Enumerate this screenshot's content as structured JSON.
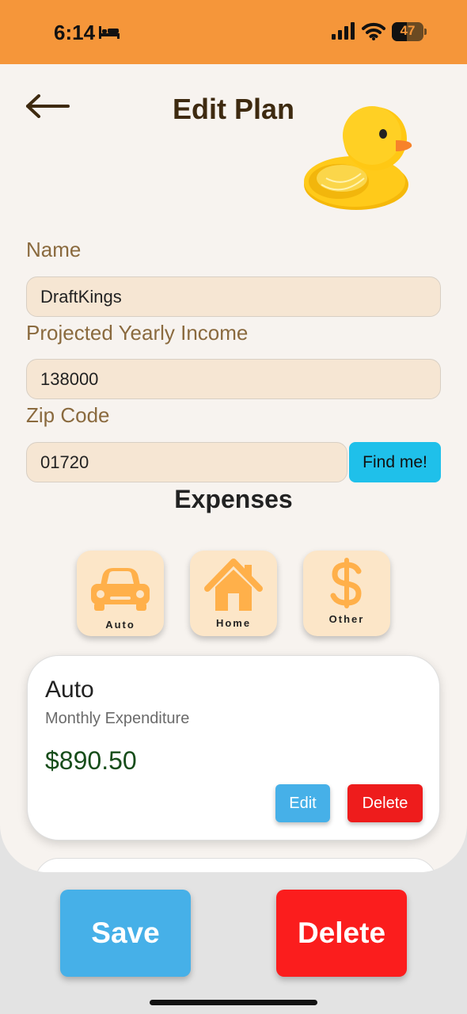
{
  "status_bar": {
    "time": "6:14",
    "battery_level": "47",
    "background_color": "#f5963a",
    "icons": [
      "bed-icon",
      "signal-icon",
      "wifi-icon",
      "battery-icon"
    ]
  },
  "header": {
    "title": "Edit Plan",
    "back_icon": "back-arrow-icon",
    "mascot_icon": "rubber-duck-icon"
  },
  "form": {
    "name": {
      "label": "Name",
      "value": "DraftKings"
    },
    "income": {
      "label": "Projected Yearly Income",
      "value": "138000"
    },
    "zip": {
      "label": "Zip Code",
      "value": "01720"
    },
    "find_button": "Find me!"
  },
  "expenses": {
    "title": "Expenses",
    "categories": [
      {
        "label": "Auto",
        "icon": "car-icon"
      },
      {
        "label": "Home",
        "icon": "house-icon"
      },
      {
        "label": "Other",
        "icon": "dollar-icon"
      }
    ],
    "items": [
      {
        "title": "Auto",
        "subtitle": "Monthly Expenditure",
        "amount": "$890.50",
        "edit_label": "Edit",
        "delete_label": "Delete"
      }
    ]
  },
  "actions": {
    "save_label": "Save",
    "delete_label": "Delete"
  },
  "colors": {
    "accent_orange": "#f5963a",
    "button_blue": "#46b0e8",
    "button_red": "#fb1d1d",
    "find_button_cyan": "#1fc0ea",
    "input_background": "#f6e6d3",
    "amount_green": "#174d1a"
  }
}
